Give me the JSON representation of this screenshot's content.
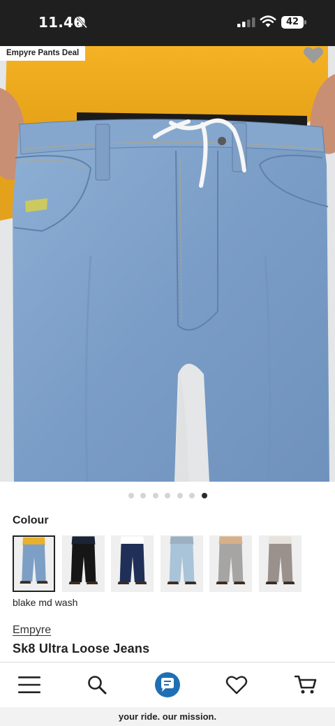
{
  "status_bar": {
    "time": "11.46",
    "battery": "42",
    "icons": [
      "bell-muted-icon",
      "signal-icon",
      "wifi-icon",
      "battery-icon"
    ]
  },
  "hero": {
    "deal_tag": "Empyre Pants Deal",
    "wishlist_icon": "heart-icon",
    "carousel": {
      "count": 7,
      "active_index": 6
    }
  },
  "colour": {
    "label": "Colour",
    "selected_variant": "blake md wash",
    "swatches": [
      {
        "name": "blake md wash",
        "top_color": "#e9b12a",
        "pant_color": "#7d9fc6",
        "selected": true
      },
      {
        "name": "black",
        "top_color": "#1b2436",
        "pant_color": "#161616",
        "selected": false
      },
      {
        "name": "dark blue",
        "top_color": "#ffffff",
        "pant_color": "#1f2f57",
        "selected": false
      },
      {
        "name": "light blue",
        "top_color": "#9bb0c2",
        "pant_color": "#a9c3d9",
        "selected": false
      },
      {
        "name": "grey",
        "top_color": "#d7b08a",
        "pant_color": "#a7a5a3",
        "selected": false
      },
      {
        "name": "grey brown",
        "top_color": "#e8e2dc",
        "pant_color": "#9a918d",
        "selected": false
      }
    ]
  },
  "product": {
    "brand": "Empyre",
    "name": "Sk8 Ultra Loose Jeans"
  },
  "bottom_nav": {
    "items": [
      "menu-icon",
      "search-icon",
      "chat-icon",
      "heart-icon",
      "cart-icon"
    ],
    "accent": "#1f6fb5"
  },
  "footer": {
    "tagline": "your ride. our mission."
  }
}
